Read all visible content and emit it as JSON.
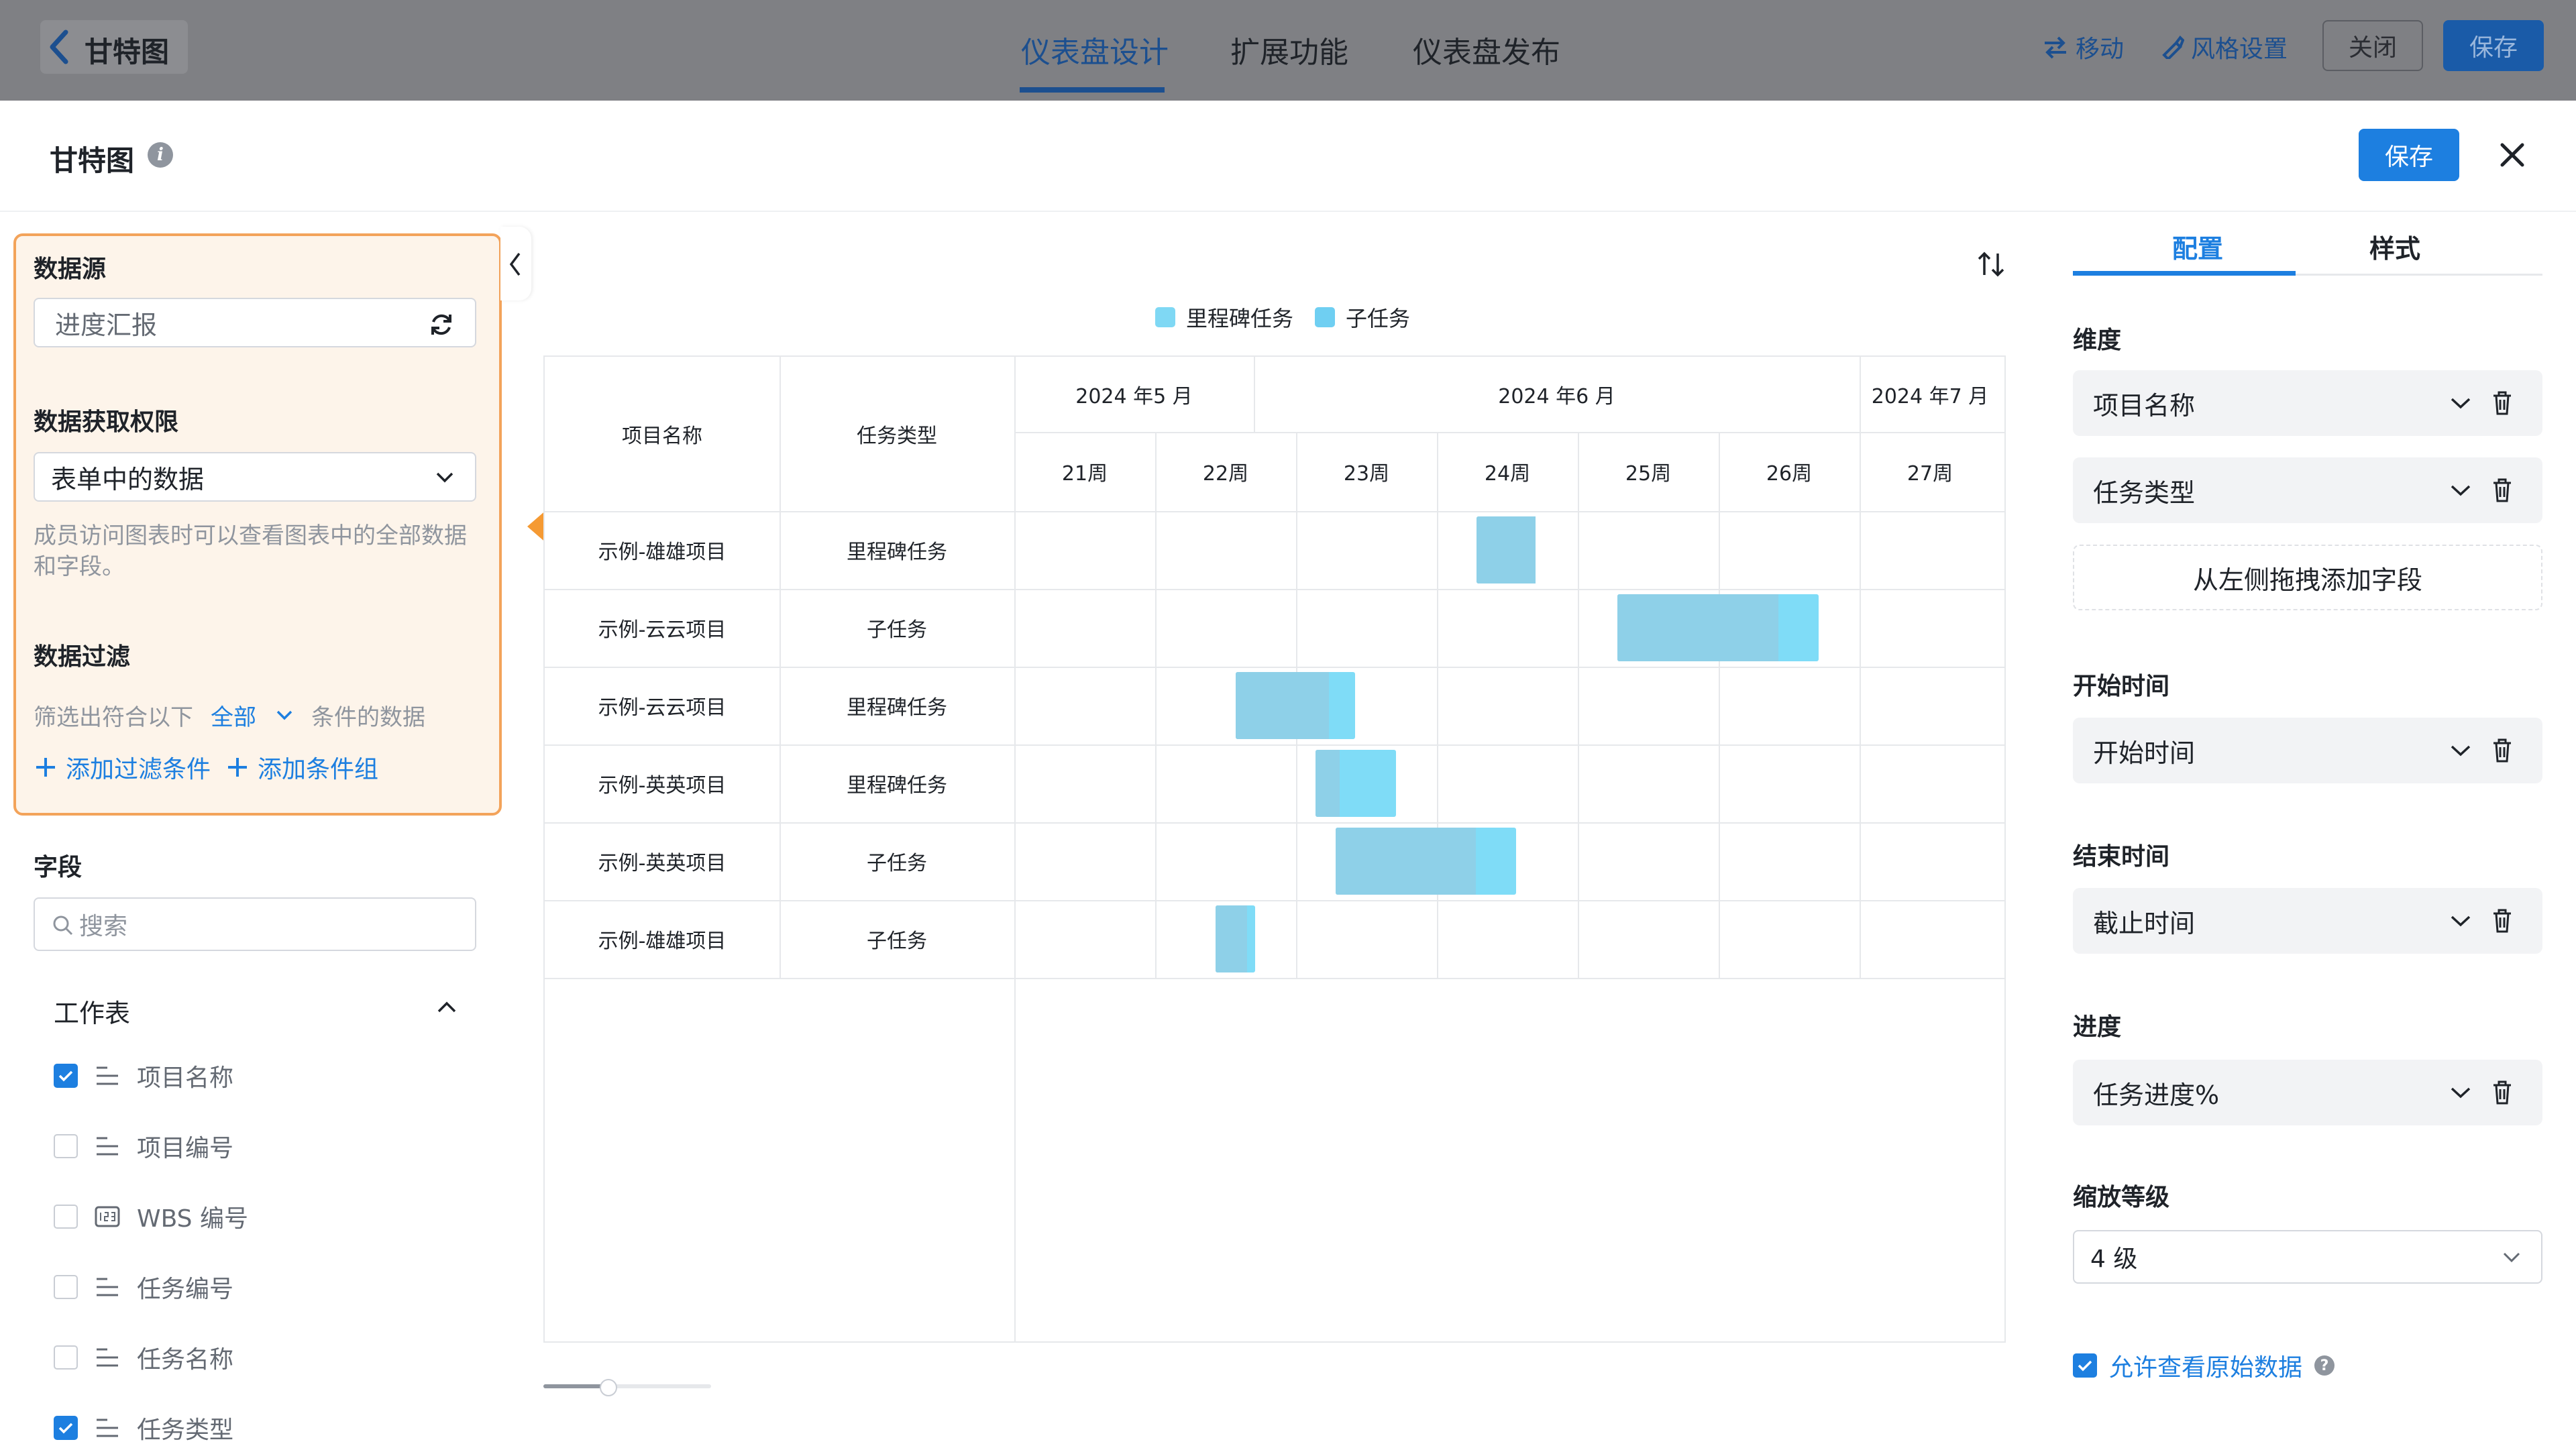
{
  "topbar": {
    "title": "甘特图",
    "nav_tabs": [
      "仪表盘设计",
      "扩展功能",
      "仪表盘发布"
    ],
    "move_label": "移动",
    "style_label": "风格设置",
    "close_label": "关闭",
    "save_label": "保存"
  },
  "modal": {
    "title": "甘特图",
    "save_label": "保存"
  },
  "left": {
    "datasource_title": "数据源",
    "datasource_value": "进度汇报",
    "permission_title": "数据获取权限",
    "permission_value": "表单中的数据",
    "permission_desc": "成员访问图表时可以查看图表中的全部数据和字段。",
    "filter_title": "数据过滤",
    "filter_prefix": "筛选出符合以下",
    "filter_mode": "全部",
    "filter_suffix": "条件的数据",
    "add_filter": "添加过滤条件",
    "add_group": "添加条件组",
    "fields_title": "字段",
    "search_placeholder": "搜索",
    "worksheet_label": "工作表",
    "fields": [
      {
        "label": "项目名称",
        "checked": true,
        "icon": "text-lines-icon"
      },
      {
        "label": "项目编号",
        "checked": false,
        "icon": "text-lines-icon"
      },
      {
        "label": "WBS 编号",
        "checked": false,
        "icon": "number-icon"
      },
      {
        "label": "任务编号",
        "checked": false,
        "icon": "text-lines-icon"
      },
      {
        "label": "任务名称",
        "checked": false,
        "icon": "text-lines-icon"
      },
      {
        "label": "任务类型",
        "checked": true,
        "icon": "text-lines-icon"
      }
    ]
  },
  "gantt": {
    "legend": [
      {
        "name": "里程碑任务",
        "color": "#7fd8f4"
      },
      {
        "name": "子任务",
        "color": "#6fcff2"
      }
    ],
    "col_project": "项目名称",
    "col_type": "任务类型",
    "months": [
      "2024 年5 月",
      "2024 年6 月",
      "2024 年7 月"
    ],
    "weeks": [
      "21周",
      "22周",
      "23周",
      "24周",
      "25周",
      "26周",
      "27周"
    ],
    "rows": [
      {
        "project": "示例-雄雄项目",
        "type": "里程碑任务",
        "start": 3.28,
        "end": 3.7,
        "progress": 1.0
      },
      {
        "project": "示例-云云项目",
        "type": "子任务",
        "start": 4.28,
        "end": 5.71,
        "progress": 0.8
      },
      {
        "project": "示例-云云项目",
        "type": "里程碑任务",
        "start": 1.57,
        "end": 2.42,
        "progress": 0.78
      },
      {
        "project": "示例-英英项目",
        "type": "里程碑任务",
        "start": 2.14,
        "end": 2.71,
        "progress": 0.3
      },
      {
        "project": "示例-英英项目",
        "type": "子任务",
        "start": 2.28,
        "end": 3.56,
        "progress": 0.78
      },
      {
        "project": "示例-雄雄项目",
        "type": "子任务",
        "start": 1.43,
        "end": 1.71,
        "progress": 0.8
      }
    ],
    "colors": {
      "done": "#8ed0e8",
      "remaining": "#7fdcf7"
    }
  },
  "right": {
    "tabs": [
      "配置",
      "样式"
    ],
    "dimension_title": "维度",
    "dimension_fields": [
      "项目名称",
      "任务类型"
    ],
    "drag_hint": "从左侧拖拽添加字段",
    "start_title": "开始时间",
    "start_value": "开始时间",
    "end_title": "结束时间",
    "end_value": "截止时间",
    "progress_title": "进度",
    "progress_value": "任务进度%",
    "zoom_title": "缩放等级",
    "zoom_value": "4 级",
    "allow_raw": "允许查看原始数据"
  }
}
